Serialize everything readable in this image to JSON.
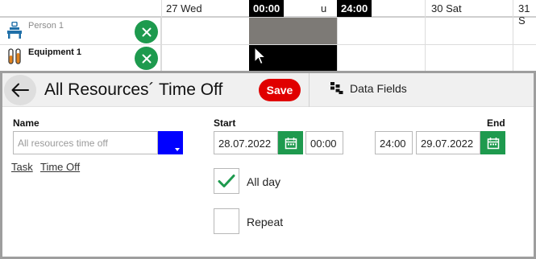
{
  "timeline": {
    "days": [
      "27 Wed",
      "30 Sat",
      "31 S"
    ],
    "partial_day": "u",
    "start_time": "00:00",
    "end_time": "24:00",
    "resources": [
      {
        "name": "Person 1",
        "icon": "person-desk-icon"
      },
      {
        "name": "Equipment 1",
        "icon": "test-tubes-icon"
      }
    ]
  },
  "dialog": {
    "title": "All Resources´ Time Off",
    "save_label": "Save",
    "data_fields_label": "Data Fields",
    "name_label": "Name",
    "name_placeholder": "All resources time off",
    "task_link": "Task",
    "time_off_link": "Time Off",
    "start_label": "Start",
    "end_label": "End",
    "start_date": "28.07.2022",
    "start_time": "00:00",
    "end_time": "24:00",
    "end_date": "29.07.2022",
    "all_day_label": "All day",
    "all_day_checked": true,
    "repeat_label": "Repeat",
    "repeat_checked": false
  },
  "colors": {
    "accent_green": "#1e9a4e",
    "save_red": "#e00000",
    "dropdown_blue": "#0000ff",
    "dialog_border": "#9e9e9e"
  }
}
